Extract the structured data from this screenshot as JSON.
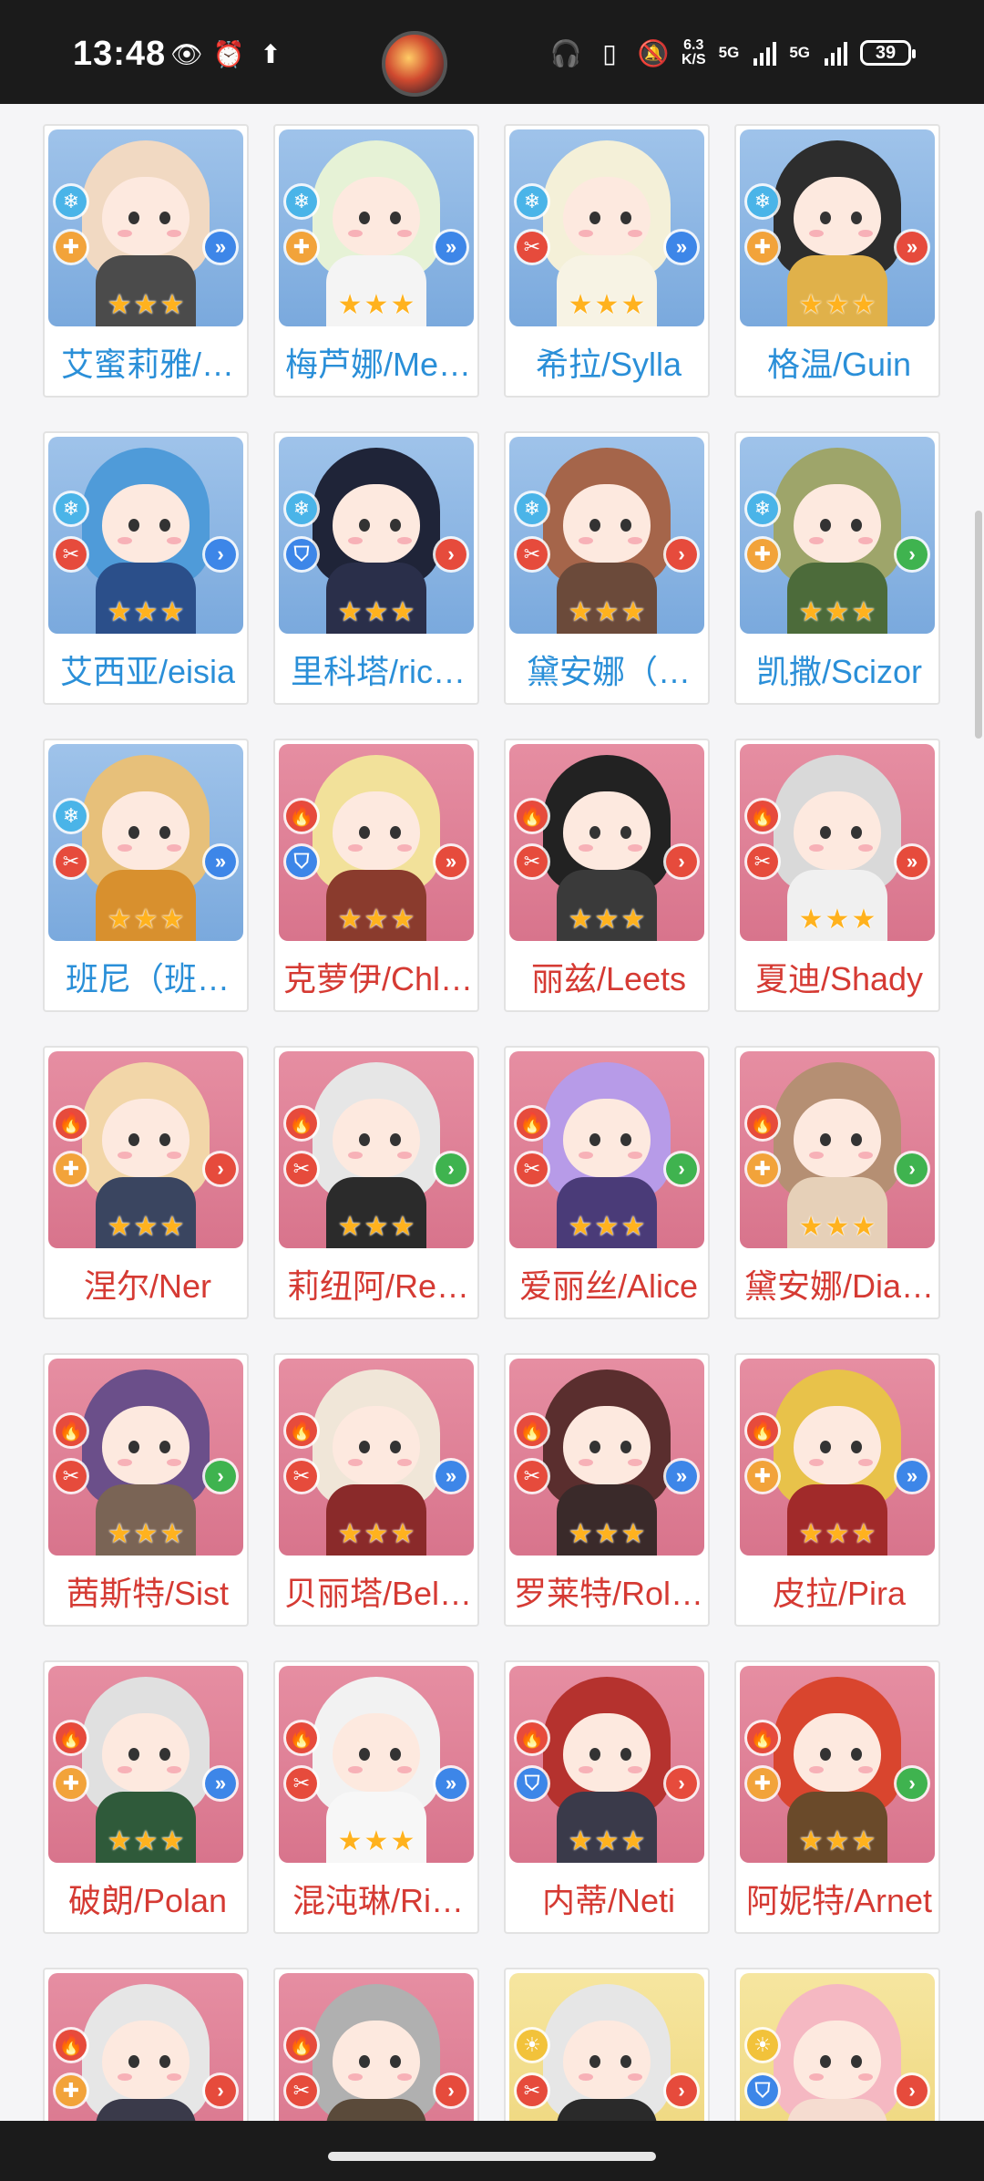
{
  "status_bar": {
    "time": "13:48",
    "net_speed_top": "6.3",
    "net_speed_bottom": "K/S",
    "sig1_label": "5G",
    "sig2_label": "5G",
    "battery": "39"
  },
  "colors": {
    "blue": "#7aa9dd",
    "red": "#d8748c",
    "yellow": "#eed57a",
    "star": "#ffb21e"
  },
  "grid": {
    "rows": [
      [
        {
          "name": "艾蜜莉雅/…",
          "theme": "blue",
          "elem": "snowflake-icon",
          "role": "cross-icon",
          "roleColor": "#f2a33a",
          "arrow": "double-arrow-icon",
          "arrowColor": "#3d86e8",
          "hair": "#f1d9c2",
          "body": "#4b4b4b"
        },
        {
          "name": "梅芦娜/Me…",
          "theme": "blue",
          "elem": "snowflake-icon",
          "role": "cross-icon",
          "roleColor": "#f2a33a",
          "arrow": "double-arrow-icon",
          "arrowColor": "#3d86e8",
          "hair": "#e6f2d6",
          "body": "#f4f4f4"
        },
        {
          "name": "希拉/Sylla",
          "theme": "blue",
          "elem": "snowflake-icon",
          "role": "swords-icon",
          "roleColor": "#e64b3c",
          "arrow": "double-arrow-icon",
          "arrowColor": "#3d86e8",
          "hair": "#f4f0d8",
          "body": "#f7f3e4"
        },
        {
          "name": "格温/Guin",
          "theme": "blue",
          "elem": "snowflake-icon",
          "role": "cross-icon",
          "roleColor": "#f2a33a",
          "arrow": "double-arrow-icon",
          "arrowColor": "#e64b3c",
          "hair": "#2d2d2d",
          "body": "#e0b14a"
        }
      ],
      [
        {
          "name": "艾西亚/eisia",
          "theme": "blue",
          "elem": "snowflake-icon",
          "role": "swords-icon",
          "roleColor": "#e64b3c",
          "arrow": "single-arrow-icon",
          "arrowColor": "#3d86e8",
          "hair": "#4f9bd9",
          "body": "#2b4f8a"
        },
        {
          "name": "里科塔/ric…",
          "theme": "blue",
          "elem": "snowflake-icon",
          "role": "shield-icon",
          "roleColor": "#3d86e8",
          "arrow": "single-arrow-icon",
          "arrowColor": "#e64b3c",
          "hair": "#1f2438",
          "body": "#2a2f4a"
        },
        {
          "name": "黛安娜（…",
          "theme": "blue",
          "elem": "snowflake-icon",
          "role": "swords-icon",
          "roleColor": "#e64b3c",
          "arrow": "single-arrow-icon",
          "arrowColor": "#e64b3c",
          "hair": "#a5654a",
          "body": "#6b4a3a"
        },
        {
          "name": "凯撒/Scizor",
          "theme": "blue",
          "elem": "snowflake-icon",
          "role": "cross-icon",
          "roleColor": "#f2a33a",
          "arrow": "single-arrow-icon",
          "arrowColor": "#3fb34f",
          "hair": "#9ea56a",
          "body": "#4c6b3a"
        }
      ],
      [
        {
          "name": "班尼（班…",
          "theme": "blue",
          "elem": "snowflake-icon",
          "role": "swords-icon",
          "roleColor": "#e64b3c",
          "arrow": "double-arrow-icon",
          "arrowColor": "#3d86e8",
          "hair": "#e7c07a",
          "body": "#d8902e"
        },
        {
          "name": "克萝伊/Chl…",
          "theme": "red",
          "elem": "fire-icon",
          "role": "shield-icon",
          "roleColor": "#3d86e8",
          "arrow": "double-arrow-icon",
          "arrowColor": "#e64b3c",
          "hair": "#f2e19a",
          "body": "#8a3b2d"
        },
        {
          "name": "丽兹/Leets",
          "theme": "red",
          "elem": "fire-icon",
          "role": "swords-icon",
          "roleColor": "#e64b3c",
          "arrow": "single-arrow-icon",
          "arrowColor": "#e64b3c",
          "hair": "#222222",
          "body": "#3a3a3a"
        },
        {
          "name": "夏迪/Shady",
          "theme": "red",
          "elem": "fire-icon",
          "role": "swords-icon",
          "roleColor": "#e64b3c",
          "arrow": "double-arrow-icon",
          "arrowColor": "#e64b3c",
          "hair": "#d9d9d9",
          "body": "#f0f0f0"
        }
      ],
      [
        {
          "name": "涅尔/Ner",
          "theme": "red",
          "elem": "fire-icon",
          "role": "cross-icon",
          "roleColor": "#f2a33a",
          "arrow": "single-arrow-icon",
          "arrowColor": "#e64b3c",
          "hair": "#f2d6a8",
          "body": "#3a4560"
        },
        {
          "name": "莉纽阿/Re…",
          "theme": "red",
          "elem": "fire-icon",
          "role": "swords-icon",
          "roleColor": "#e64b3c",
          "arrow": "single-arrow-icon",
          "arrowColor": "#3fb34f",
          "hair": "#e6e6e6",
          "body": "#2b2b2b"
        },
        {
          "name": "爱丽丝/Alice",
          "theme": "red",
          "elem": "fire-icon",
          "role": "swords-icon",
          "roleColor": "#e64b3c",
          "arrow": "single-arrow-icon",
          "arrowColor": "#3fb34f",
          "hair": "#b79be8",
          "body": "#4a3b78"
        },
        {
          "name": "黛安娜/Dia…",
          "theme": "red",
          "elem": "fire-icon",
          "role": "cross-icon",
          "roleColor": "#f2a33a",
          "arrow": "single-arrow-icon",
          "arrowColor": "#3fb34f",
          "hair": "#b58f73",
          "body": "#e6d0b8"
        }
      ],
      [
        {
          "name": "茜斯特/Sist",
          "theme": "red",
          "elem": "fire-icon",
          "role": "swords-icon",
          "roleColor": "#e64b3c",
          "arrow": "single-arrow-icon",
          "arrowColor": "#3fb34f",
          "hair": "#6b4f8a",
          "body": "#7a6455"
        },
        {
          "name": "贝丽塔/Bel…",
          "theme": "red",
          "elem": "fire-icon",
          "role": "swords-icon",
          "roleColor": "#e64b3c",
          "arrow": "double-arrow-icon",
          "arrowColor": "#3d86e8",
          "hair": "#f0e6d8",
          "body": "#8a2a2a"
        },
        {
          "name": "罗莱特/Rol…",
          "theme": "red",
          "elem": "fire-icon",
          "role": "swords-icon",
          "roleColor": "#e64b3c",
          "arrow": "double-arrow-icon",
          "arrowColor": "#3d86e8",
          "hair": "#5a2e2e",
          "body": "#3a2a2a"
        },
        {
          "name": "皮拉/Pira",
          "theme": "red",
          "elem": "fire-icon",
          "role": "cross-icon",
          "roleColor": "#f2a33a",
          "arrow": "double-arrow-icon",
          "arrowColor": "#3d86e8",
          "hair": "#e8c24a",
          "body": "#a12a2a"
        }
      ],
      [
        {
          "name": "破朗/Polan",
          "theme": "red",
          "elem": "fire-icon",
          "role": "cross-icon",
          "roleColor": "#f2a33a",
          "arrow": "double-arrow-icon",
          "arrowColor": "#3d86e8",
          "hair": "#e0e0e0",
          "body": "#2f5a3a"
        },
        {
          "name": "混沌琳/Ri…",
          "theme": "red",
          "elem": "fire-icon",
          "role": "swords-icon",
          "roleColor": "#e64b3c",
          "arrow": "double-arrow-icon",
          "arrowColor": "#3d86e8",
          "hair": "#f2f2f2",
          "body": "#f7f7f7"
        },
        {
          "name": "内蒂/Neti",
          "theme": "red",
          "elem": "fire-icon",
          "role": "shield-icon",
          "roleColor": "#3d86e8",
          "arrow": "single-arrow-icon",
          "arrowColor": "#e64b3c",
          "hair": "#b5322e",
          "body": "#3a3a4a"
        },
        {
          "name": "阿妮特/Arnet",
          "theme": "red",
          "elem": "fire-icon",
          "role": "cross-icon",
          "roleColor": "#f2a33a",
          "arrow": "single-arrow-icon",
          "arrowColor": "#3fb34f",
          "hair": "#d9452e",
          "body": "#6a4a2a"
        }
      ],
      [
        {
          "name": "",
          "theme": "red",
          "elem": "fire-icon",
          "role": "cross-icon",
          "roleColor": "#f2a33a",
          "arrow": "single-arrow-icon",
          "arrowColor": "#e64b3c",
          "hair": "#e6e6e6",
          "body": "#3a3a4a"
        },
        {
          "name": "",
          "theme": "red",
          "elem": "fire-icon",
          "role": "swords-icon",
          "roleColor": "#e64b3c",
          "arrow": "single-arrow-icon",
          "arrowColor": "#e64b3c",
          "hair": "#b0b0b0",
          "body": "#5a4a3a"
        },
        {
          "name": "",
          "theme": "yellow",
          "elem": "sun-icon",
          "role": "swords-icon",
          "roleColor": "#e64b3c",
          "arrow": "single-arrow-icon",
          "arrowColor": "#e64b3c",
          "hair": "#e6e6e6",
          "body": "#2a2a2a"
        },
        {
          "name": "",
          "theme": "yellow",
          "elem": "sun-icon",
          "role": "shield-icon",
          "roleColor": "#3d86e8",
          "arrow": "single-arrow-icon",
          "arrowColor": "#e64b3c",
          "hair": "#f5b8c2",
          "body": "#f5dcd0"
        }
      ]
    ]
  }
}
